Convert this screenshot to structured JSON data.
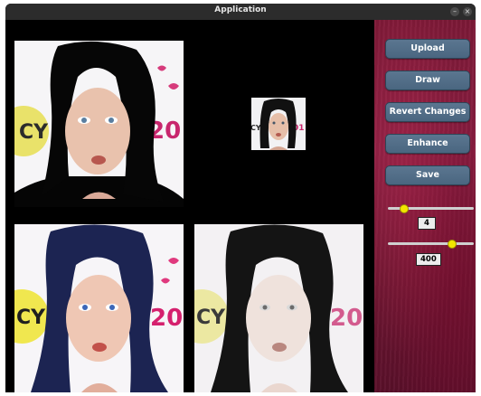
{
  "window": {
    "title": "Application"
  },
  "sidebar": {
    "buttons": {
      "upload": "Upload",
      "draw": "Draw",
      "revert": "Revert Changes",
      "enhance": "Enhance",
      "save": "Save"
    },
    "sliders": [
      {
        "value": "4",
        "fraction": 0.18
      },
      {
        "value": "400",
        "fraction": 0.74
      }
    ]
  },
  "images": {
    "segmented": {
      "kind": "segmented-portrait"
    },
    "thumbnail": {
      "kind": "original-thumbnail"
    },
    "enhanced_color": {
      "kind": "enhanced-portrait"
    },
    "enhanced_gray": {
      "kind": "grayscale-portrait"
    }
  },
  "colors": {
    "accent_button": "#4a6680",
    "slider_thumb": "#f2e600",
    "sidebar_bg": "#7d1937"
  }
}
